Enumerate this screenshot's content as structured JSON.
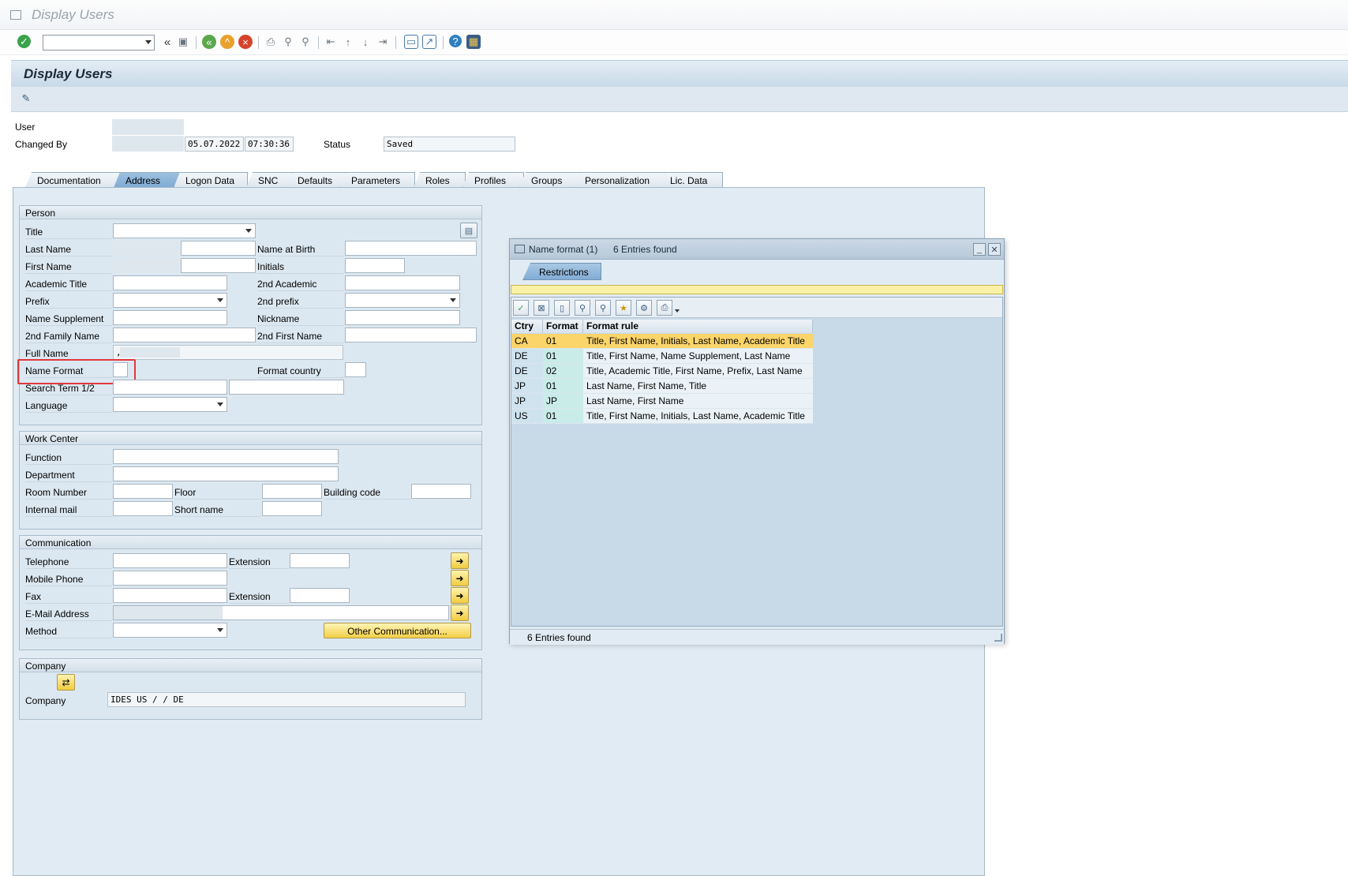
{
  "window": {
    "title": "Display Users"
  },
  "header": {
    "title": "Display Users"
  },
  "user_info": {
    "user_label": "User",
    "changed_by_label": "Changed By",
    "changed_date": "05.07.2022",
    "changed_time": "07:30:36",
    "status_label": "Status",
    "status_value": "Saved"
  },
  "tabs": [
    "Documentation",
    "Address",
    "Logon Data",
    "SNC",
    "Defaults",
    "Parameters",
    "Roles",
    "Profiles",
    "Groups",
    "Personalization",
    "Lic. Data"
  ],
  "person": {
    "heading": "Person",
    "title": "Title",
    "last_name": "Last Name",
    "name_at_birth": "Name at Birth",
    "first_name": "First Name",
    "initials": "Initials",
    "academic_title": "Academic Title",
    "second_academic": "2nd Academic",
    "prefix": "Prefix",
    "second_prefix": "2nd prefix",
    "name_supplement": "Name Supplement",
    "nickname": "Nickname",
    "second_family_name": "2nd Family Name",
    "second_first_name": "2nd First Name",
    "full_name": "Full Name",
    "full_name_value": ",",
    "name_format": "Name Format",
    "format_country": "Format country",
    "search_term": "Search Term 1/2",
    "language": "Language"
  },
  "work_center": {
    "heading": "Work Center",
    "function": "Function",
    "department": "Department",
    "room_number": "Room Number",
    "floor": "Floor",
    "building_code": "Building code",
    "internal_mail": "Internal mail",
    "short_name": "Short name"
  },
  "communication": {
    "heading": "Communication",
    "telephone": "Telephone",
    "extension": "Extension",
    "mobile_phone": "Mobile Phone",
    "fax": "Fax",
    "fax_extension": "Extension",
    "email": "E-Mail Address",
    "method": "Method",
    "other_button": "Other Communication..."
  },
  "company": {
    "heading": "Company",
    "label": "Company",
    "value": "IDES US /   / DE"
  },
  "popup": {
    "title": "Name format (1)",
    "entries": "6 Entries found",
    "restrictions_tab": "Restrictions",
    "columns": [
      "Ctry",
      "Format",
      "Format rule"
    ],
    "rows": [
      {
        "ctry": "CA",
        "format": "01",
        "rule": "Title, First Name, Initials, Last Name, Academic Title"
      },
      {
        "ctry": "DE",
        "format": "01",
        "rule": "Title, First Name, Name Supplement, Last Name"
      },
      {
        "ctry": "DE",
        "format": "02",
        "rule": "Title, Academic Title, First Name, Prefix, Last Name"
      },
      {
        "ctry": "JP",
        "format": "01",
        "rule": "Last Name, First Name, Title"
      },
      {
        "ctry": "JP",
        "format": "JP",
        "rule": "Last Name, First Name"
      },
      {
        "ctry": "US",
        "format": "01",
        "rule": "Title, First Name, Initials, Last Name, Academic Title"
      }
    ],
    "status": "6 Entries found"
  },
  "icons": {
    "enter": "check-icon",
    "save": "save-icon",
    "back": "back-icon",
    "exit": "exit-icon",
    "cancel": "cancel-icon",
    "help": "help-icon"
  }
}
